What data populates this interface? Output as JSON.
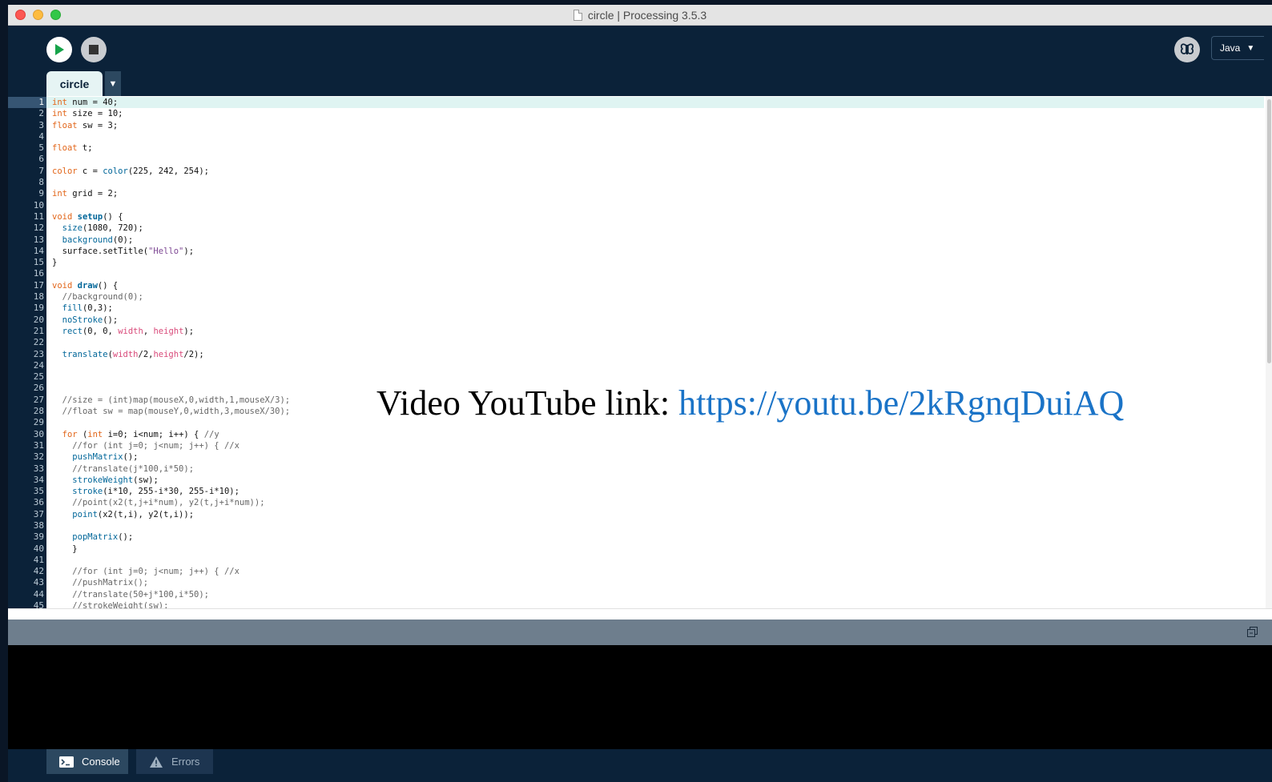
{
  "window": {
    "title": "circle | Processing 3.5.3"
  },
  "toolbar": {
    "mode": "Java",
    "run_icon": "play-icon",
    "stop_icon": "stop-icon",
    "debug_icon": "butterfly-icon"
  },
  "tabs": [
    {
      "label": "circle"
    }
  ],
  "editor": {
    "current_line": 1,
    "line_count": 45,
    "lines": [
      "int num = 40;",
      "int size = 10;",
      "float sw = 3;",
      "",
      "float t;",
      "",
      "color c = color(225, 242, 254);",
      "",
      "int grid = 2;",
      "",
      "void setup() {",
      "  size(1080, 720);",
      "  background(0);",
      "  surface.setTitle(\"Hello\");",
      "}",
      "",
      "void draw() {",
      "  //background(0);",
      "  fill(0,3);",
      "  noStroke();",
      "  rect(0, 0, width, height);",
      "",
      "  translate(width/2,height/2);",
      "",
      "",
      "",
      "  //size = (int)map(mouseX,0,width,1,mouseX/3);",
      "  //float sw = map(mouseY,0,width,3,mouseX/30);",
      "",
      "  for (int i=0; i<num; i++) { //y",
      "    //for (int j=0; j<num; j++) { //x",
      "    pushMatrix();",
      "    //translate(j*100,i*50);",
      "    strokeWeight(sw);",
      "    stroke(i*10, 255-i*30, 255-i*10);",
      "    //point(x2(t,j+i*num), y2(t,j+i*num));",
      "    point(x2(t,i), y2(t,i));",
      "",
      "    popMatrix();",
      "    }",
      "",
      "    //for (int j=0; j<num; j++) { //x",
      "    //pushMatrix();",
      "    //translate(50+j*100,i*50);",
      "    //strokeWeight(sw);"
    ]
  },
  "overlay": {
    "prefix": "Video YouTube link: ",
    "link": "https://youtu.be/2kRgnqDuiAQ"
  },
  "bottom_tabs": {
    "console": "Console",
    "errors": "Errors"
  },
  "colors": {
    "background": "#0b2239",
    "editor_bg": "#ffffff",
    "current_line": "#dff4f2",
    "keyword": "#e2661a",
    "builtin": "#006699",
    "link": "#1a73c7"
  }
}
